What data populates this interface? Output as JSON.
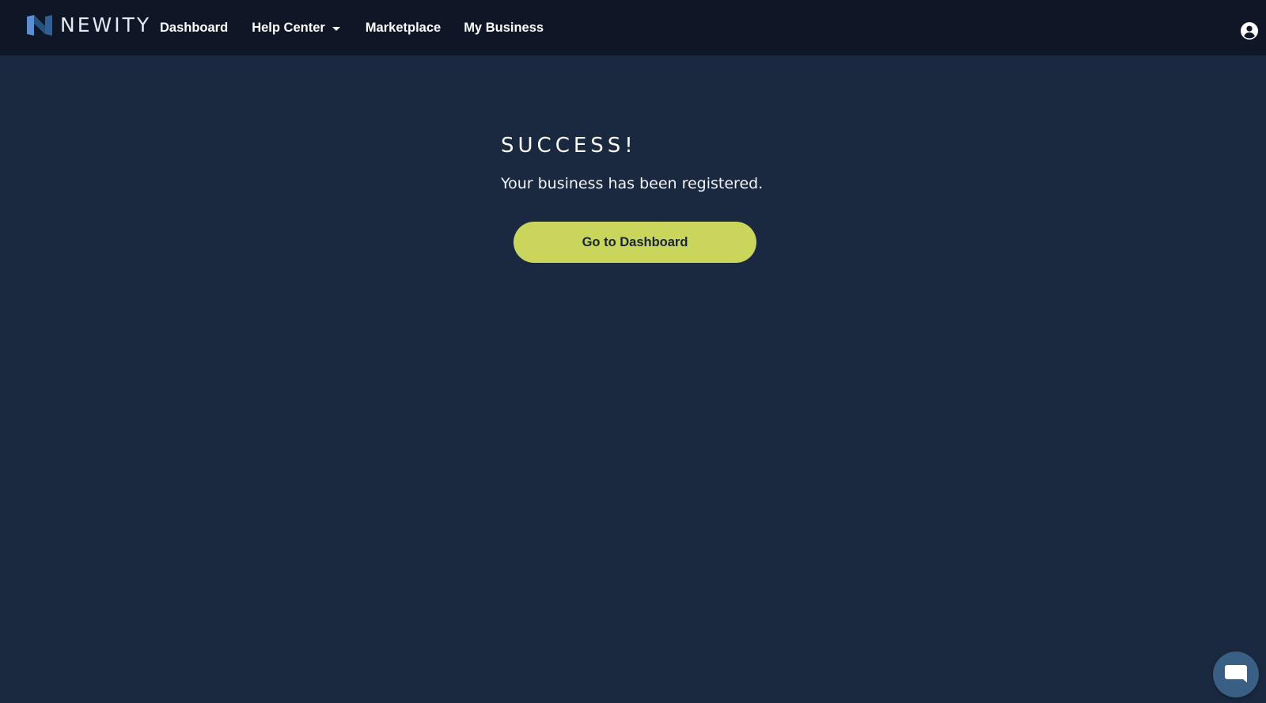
{
  "brand": {
    "name": "NEWITY",
    "logo_icon": "newity-logo-icon"
  },
  "nav": {
    "items": [
      {
        "label": "Dashboard"
      },
      {
        "label": "Help Center",
        "has_dropdown": true
      },
      {
        "label": "Marketplace"
      },
      {
        "label": "My Business"
      }
    ]
  },
  "header": {
    "user_icon": "user-circle-icon"
  },
  "main": {
    "title": "SUCCESS!",
    "message": "Your business has been registered.",
    "button_label": "Go to Dashboard"
  },
  "chat": {
    "icon": "chat-bubble-icon"
  },
  "colors": {
    "background": "#1b2940",
    "topbar": "#0f1726",
    "accent": "#cad65b",
    "chat": "#3a5f84"
  }
}
